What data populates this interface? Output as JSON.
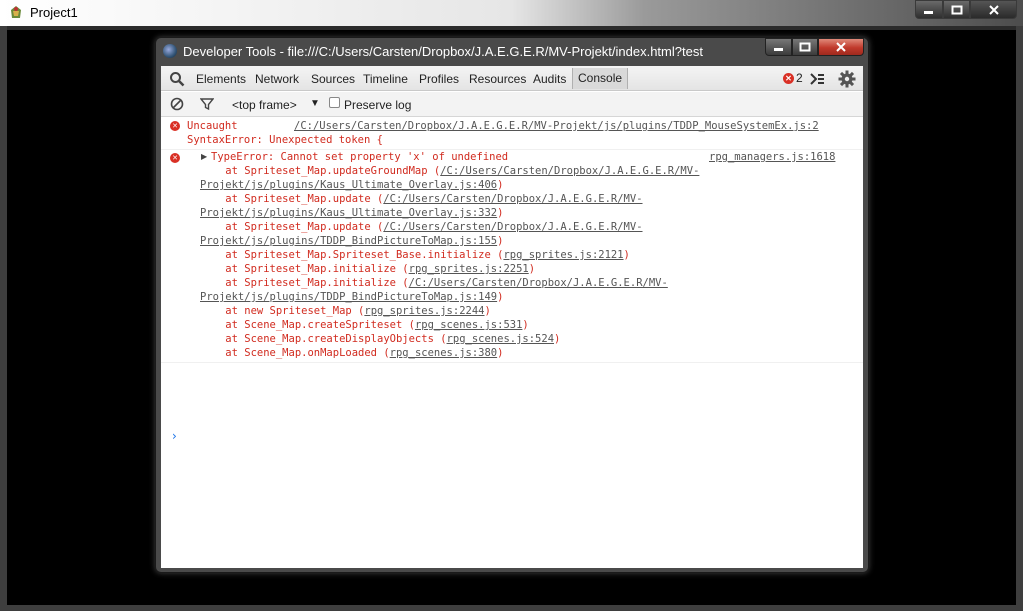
{
  "outer_window": {
    "title": "Project1",
    "controls": {
      "minimize": "▬",
      "maximize": "▢",
      "close": "✕"
    }
  },
  "devtools_window": {
    "title": "Developer Tools - file:///C:/Users/Carsten/Dropbox/J.A.E.G.E.R/MV-Projekt/index.html?test",
    "controls": {
      "minimize": "▬",
      "maximize": "▢",
      "close": "✕"
    }
  },
  "toolbar": {
    "tabs": [
      "Elements",
      "Network",
      "Sources",
      "Timeline",
      "Profiles",
      "Resources",
      "Audits",
      "Console"
    ],
    "active_tab": "Console",
    "error_count": "2"
  },
  "filterbar": {
    "frame": "<top frame>",
    "arrow": "▼",
    "preserve_log_label": "Preserve log"
  },
  "messages": {
    "error1": {
      "line1_text": "Uncaught",
      "line1_link": "/C:/Users/Carsten/Dropbox/J.A.E.G.E.R/MV-Projekt/js/plugins/TDDP_MouseSystemEx.js:2",
      "line2_text": "SyntaxError: Unexpected token {"
    },
    "error2": {
      "header": "TypeError: Cannot set property 'x' of undefined",
      "source": "rpg_managers.js:1618",
      "stack": [
        {
          "prefix": "    at Spriteset_Map.updateGroundMap (",
          "link": "/C:/Users/Carsten/Dropbox/J.A.E.G.E.R/MV-",
          "suffix": ""
        },
        {
          "prefix": "",
          "link": "Projekt/js/plugins/Kaus_Ultimate_Overlay.js:406",
          "suffix": ")"
        },
        {
          "prefix": "    at Spriteset_Map.update (",
          "link": "/C:/Users/Carsten/Dropbox/J.A.E.G.E.R/MV-",
          "suffix": ""
        },
        {
          "prefix": "",
          "link": "Projekt/js/plugins/Kaus_Ultimate_Overlay.js:332",
          "suffix": ")"
        },
        {
          "prefix": "    at Spriteset_Map.update (",
          "link": "/C:/Users/Carsten/Dropbox/J.A.E.G.E.R/MV-",
          "suffix": ""
        },
        {
          "prefix": "",
          "link": "Projekt/js/plugins/TDDP_BindPictureToMap.js:155",
          "suffix": ")"
        },
        {
          "prefix": "    at Spriteset_Map.Spriteset_Base.initialize (",
          "link": "rpg_sprites.js:2121",
          "suffix": ")"
        },
        {
          "prefix": "    at Spriteset_Map.initialize (",
          "link": "rpg_sprites.js:2251",
          "suffix": ")"
        },
        {
          "prefix": "    at Spriteset_Map.initialize (",
          "link": "/C:/Users/Carsten/Dropbox/J.A.E.G.E.R/MV-",
          "suffix": ""
        },
        {
          "prefix": "",
          "link": "Projekt/js/plugins/TDDP_BindPictureToMap.js:149",
          "suffix": ")"
        },
        {
          "prefix": "    at new Spriteset_Map (",
          "link": "rpg_sprites.js:2244",
          "suffix": ")"
        },
        {
          "prefix": "    at Scene_Map.createSpriteset (",
          "link": "rpg_scenes.js:531",
          "suffix": ")"
        },
        {
          "prefix": "    at Scene_Map.createDisplayObjects (",
          "link": "rpg_scenes.js:524",
          "suffix": ")"
        },
        {
          "prefix": "    at Scene_Map.onMapLoaded (",
          "link": "rpg_scenes.js:380",
          "suffix": ")"
        }
      ]
    }
  },
  "prompt": "›",
  "icons": {
    "app": "app-icon",
    "search": "search-icon",
    "clear": "clear-console-icon",
    "filter": "filter-icon",
    "drawer": "console-drawer-icon",
    "settings": "gear-icon",
    "error": "error-icon",
    "expand": "expand-triangle-icon"
  },
  "colors": {
    "error_red": "#d12b1f",
    "link_gray": "#555555",
    "prompt_blue": "#1a73e8",
    "close_button": "#c0392b"
  }
}
